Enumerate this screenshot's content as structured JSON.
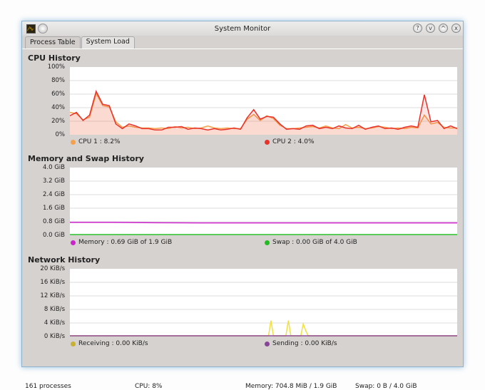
{
  "window": {
    "title": "System Monitor",
    "buttons": [
      "?",
      "v",
      "^",
      "x"
    ]
  },
  "tabs": [
    {
      "label": "Process Table",
      "active": false
    },
    {
      "label": "System Load",
      "active": true
    }
  ],
  "cpu": {
    "title": "CPU History",
    "yticks": [
      "100%",
      "80%",
      "60%",
      "40%",
      "20%",
      "0%"
    ],
    "legend": [
      {
        "label": "CPU 1 : 8.2%",
        "color": "#f5a04a"
      },
      {
        "label": "CPU 2 : 4.0%",
        "color": "#e8322c"
      }
    ]
  },
  "memory": {
    "title": "Memory and Swap History",
    "yticks": [
      "4.0 GiB",
      "3.2 GiB",
      "2.4 GiB",
      "1.6 GiB",
      "0.8 GiB",
      "0.0 GiB"
    ],
    "legend": [
      {
        "label": "Memory : 0.69 GiB of 1.9 GiB",
        "color": "#cc22cc"
      },
      {
        "label": "Swap : 0.00 GiB of 4.0 GiB",
        "color": "#22bb22"
      }
    ]
  },
  "network": {
    "title": "Network History",
    "yticks": [
      "20 KiB/s",
      "16 KiB/s",
      "12 KiB/s",
      "8 KiB/s",
      "4 KiB/s",
      "0 KiB/s"
    ],
    "legend": [
      {
        "label": "Receiving : 0.00 KiB/s",
        "color": "#c8b030"
      },
      {
        "label": "Sending : 0.00 KiB/s",
        "color": "#884499"
      }
    ]
  },
  "status": {
    "processes": "161 processes",
    "cpu": "CPU: 8%",
    "memory": "Memory: 704.8 MiB / 1.9 GiB",
    "swap": "Swap: 0 B / 4.0 GiB"
  },
  "chart_data": [
    {
      "type": "line",
      "title": "CPU History",
      "ylim": [
        0,
        100
      ],
      "series": [
        {
          "name": "CPU 1",
          "values": [
            32,
            30,
            21,
            25,
            60,
            42,
            40,
            18,
            10,
            12,
            10,
            9,
            9,
            8,
            9,
            8,
            11,
            9,
            10,
            8,
            9,
            12,
            9,
            8,
            9,
            8,
            8,
            22,
            29,
            20,
            27,
            23,
            13,
            8,
            8,
            9,
            10,
            11,
            9,
            12,
            9,
            8,
            14,
            9,
            10,
            8,
            9,
            11,
            10,
            8,
            9,
            8,
            10,
            9,
            28,
            15,
            17,
            10,
            9,
            9
          ]
        },
        {
          "name": "CPU 2",
          "values": [
            27,
            32,
            20,
            28,
            63,
            44,
            42,
            15,
            8,
            15,
            12,
            8,
            8,
            6,
            6,
            10,
            10,
            11,
            7,
            9,
            8,
            6,
            8,
            6,
            7,
            9,
            7,
            24,
            36,
            22,
            26,
            25,
            15,
            7,
            8,
            7,
            12,
            13,
            8,
            10,
            8,
            12,
            9,
            8,
            13,
            7,
            10,
            12,
            8,
            9,
            7,
            10,
            12,
            10,
            58,
            18,
            20,
            8,
            12,
            8
          ]
        }
      ]
    },
    {
      "type": "line",
      "title": "Memory and Swap History",
      "ylim": [
        0,
        4.0
      ],
      "series": [
        {
          "name": "Memory",
          "values": [
            0.72,
            0.72,
            0.7,
            0.69,
            0.69,
            0.69,
            0.69,
            0.69,
            0.69,
            0.69
          ]
        },
        {
          "name": "Swap",
          "values": [
            0,
            0,
            0,
            0,
            0,
            0,
            0,
            0,
            0,
            0
          ]
        }
      ]
    },
    {
      "type": "line",
      "title": "Network History",
      "ylim": [
        0,
        20
      ],
      "series": [
        {
          "name": "Receiving",
          "values": [
            0,
            0,
            0,
            0,
            0,
            0,
            0,
            0,
            0,
            0,
            0,
            0,
            0,
            0,
            0,
            0,
            0,
            0,
            0,
            0,
            0,
            0,
            0,
            0,
            0,
            0,
            0,
            0,
            0,
            0,
            0,
            0,
            0,
            0,
            0,
            0,
            0,
            0,
            0,
            0,
            0,
            0,
            0,
            0,
            0,
            0,
            0,
            0,
            0,
            0,
            0,
            0,
            0,
            0,
            0,
            0,
            0,
            0,
            0,
            0,
            0,
            0,
            0,
            0,
            0,
            0,
            0,
            0,
            0,
            0,
            0,
            0,
            0,
            0,
            0,
            0,
            0,
            0,
            0,
            0,
            0,
            4.5,
            0,
            0,
            0,
            0,
            0,
            0,
            4.5,
            0,
            0,
            0,
            0,
            0,
            3.5,
            1.5,
            0,
            0,
            0,
            0,
            0,
            0,
            0,
            0,
            0,
            0,
            0,
            0,
            0,
            0,
            0,
            0,
            0,
            0,
            0,
            0,
            0,
            0,
            0,
            0,
            0,
            0,
            0,
            0,
            0,
            0,
            0,
            0,
            0,
            0,
            0,
            0,
            0,
            0,
            0,
            0,
            0,
            0,
            0,
            0,
            0,
            0,
            0,
            0,
            0,
            0,
            0,
            0,
            0,
            0,
            0,
            0,
            0,
            0,
            0,
            0,
            0
          ]
        },
        {
          "name": "Sending",
          "values": [
            0,
            0
          ]
        }
      ]
    }
  ]
}
